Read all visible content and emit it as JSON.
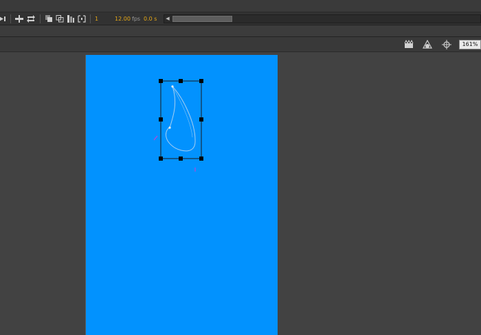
{
  "timeline": {
    "frame_number": "1",
    "fps_value": "12.00",
    "fps_unit": "fps",
    "elapsed_time": "0.0 s"
  },
  "zoom": {
    "level": "161%"
  },
  "stage": {
    "background_color": "#0292fe"
  },
  "icons": {
    "controls": [
      "step-to-end-icon",
      "center-frame-icon",
      "loop-icon",
      "onion-skin-icon",
      "onion-skin-outlines-icon",
      "edit-multiple-frames-icon",
      "modify-onion-markers-icon"
    ],
    "stage_toolbar": [
      "edit-scene-icon",
      "edit-symbols-icon",
      "snap-icon"
    ]
  },
  "colors": {
    "accent_value": "#e6a817",
    "selection_handle": "#000000",
    "stroke": "#9fc8ec",
    "anchor_point": "#d43ad4"
  }
}
